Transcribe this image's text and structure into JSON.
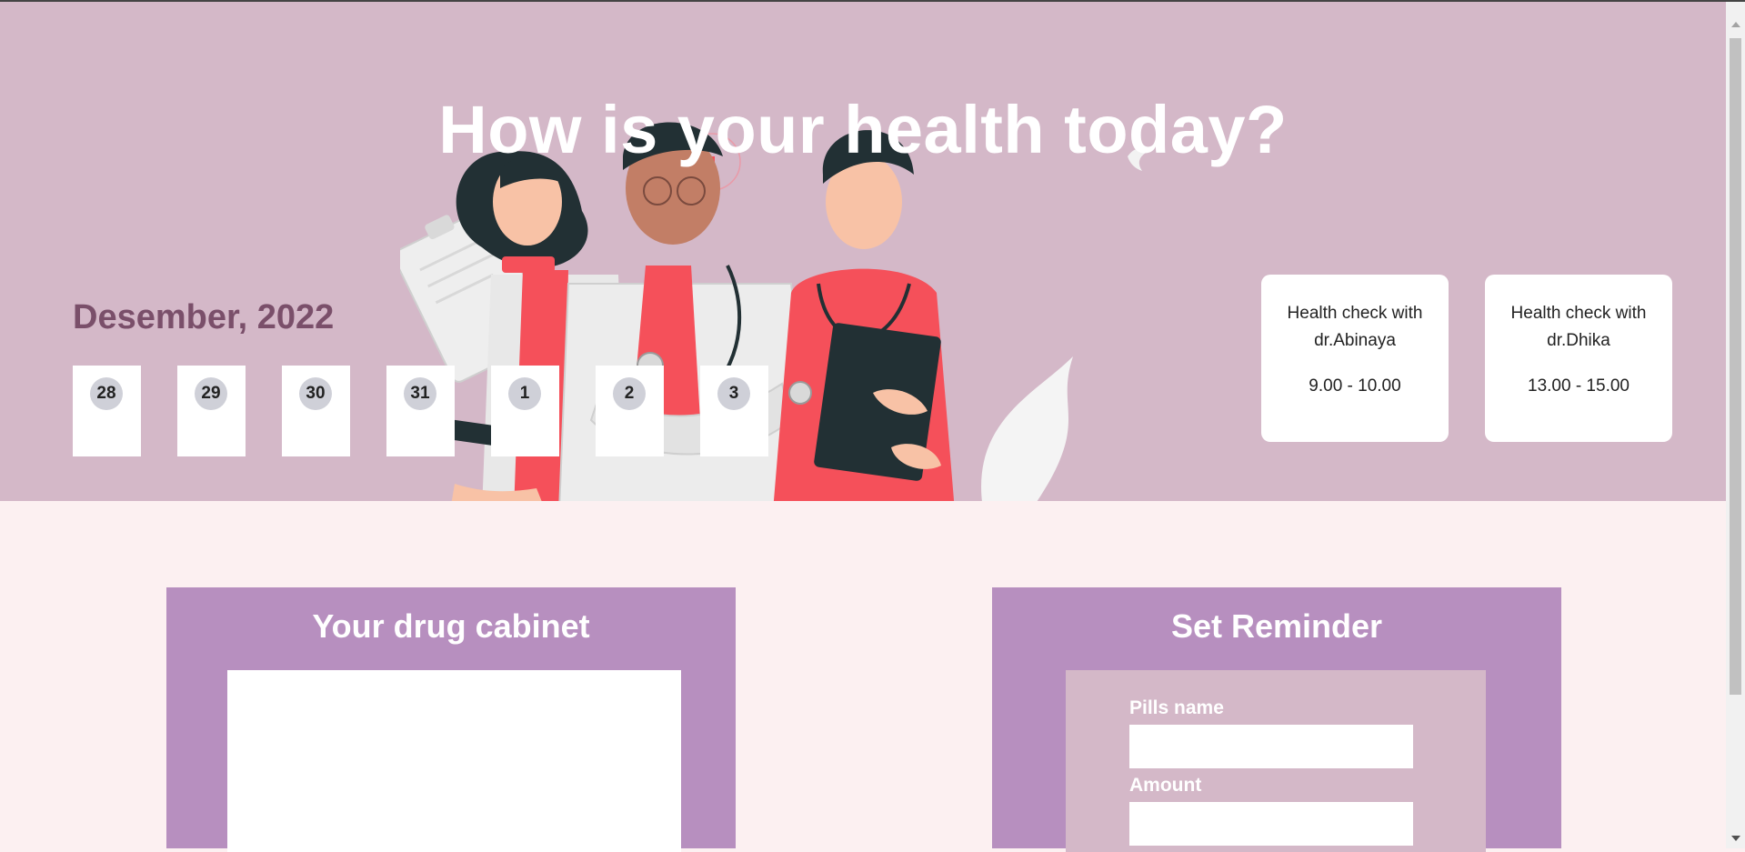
{
  "hero": {
    "title": "How is your health today?",
    "month": "Desember, 2022",
    "dates": [
      "28",
      "29",
      "30",
      "31",
      "1",
      "2",
      "3"
    ],
    "appointments": [
      {
        "title_line1": "Health check with",
        "title_line2": "dr.Abinaya",
        "time": "9.00 - 10.00"
      },
      {
        "title_line1": "Health check with",
        "title_line2": "dr.Dhika",
        "time": "13.00 - 15.00"
      }
    ]
  },
  "cabinet": {
    "title": "Your drug cabinet"
  },
  "reminder": {
    "title": "Set Reminder",
    "pills_label": "Pills name",
    "amount_label": "Amount",
    "pills_value": "",
    "amount_value": ""
  },
  "colors": {
    "hero_bg": "#d4b8c8",
    "page_bg": "#fcf0f1",
    "panel_bg": "#b78fbf",
    "month_text": "#7a4f6a",
    "accent_red": "#f5505a"
  }
}
